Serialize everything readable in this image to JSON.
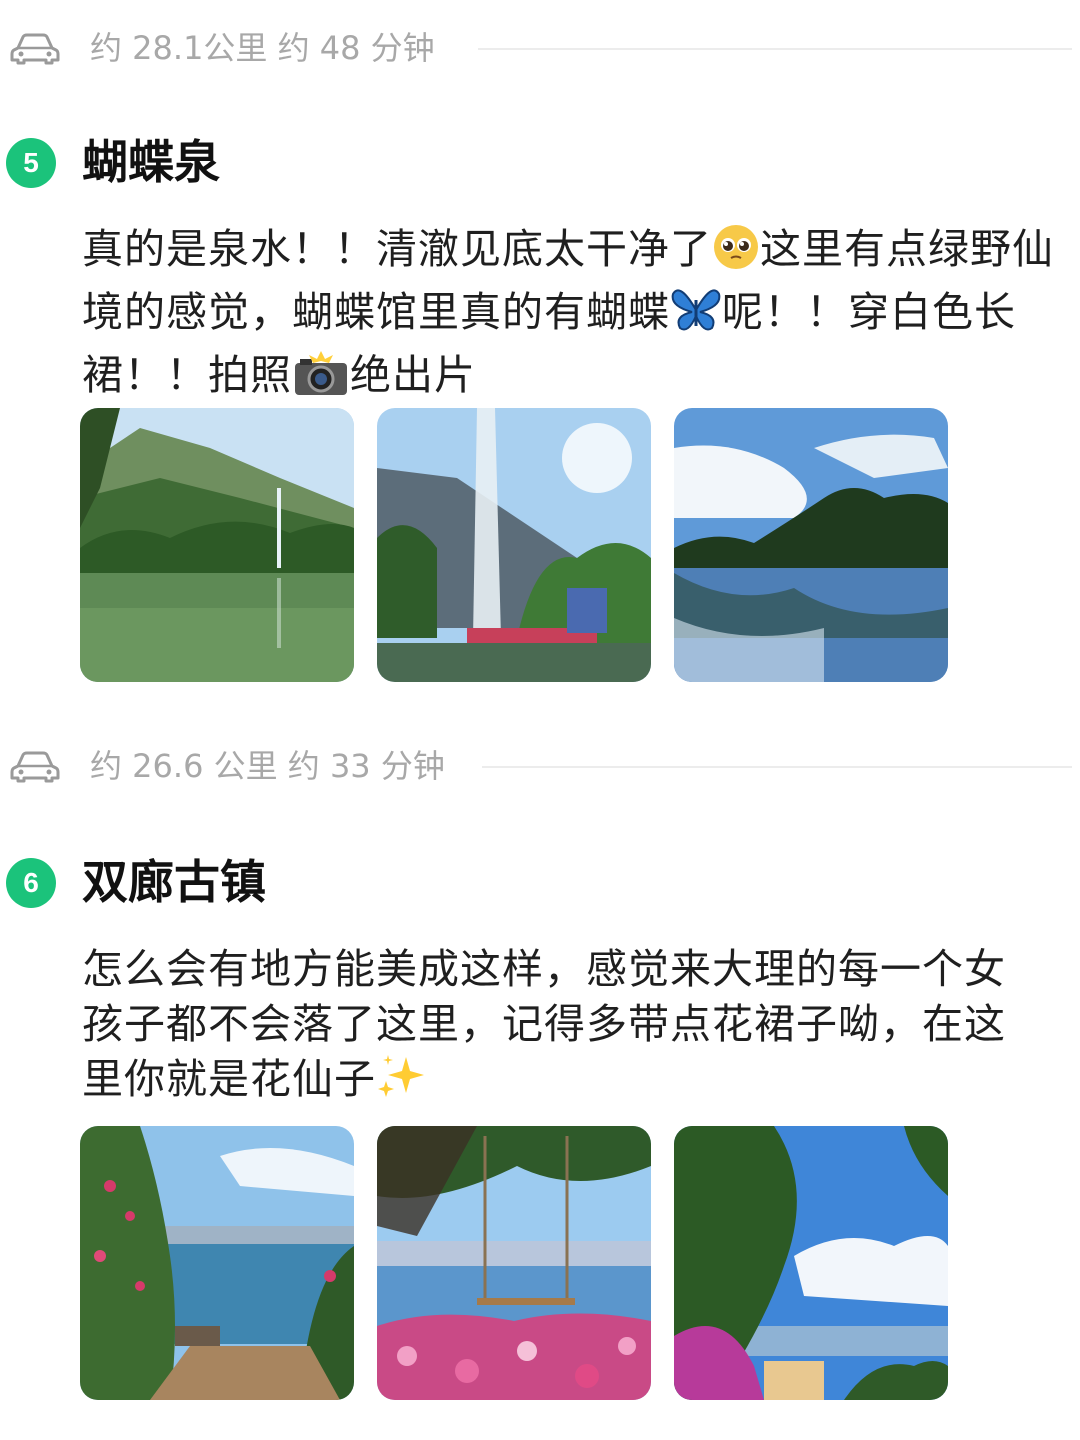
{
  "routes": [
    {
      "text": "约 28.1公里 约 48 分钟"
    },
    {
      "text": "约 26.6 公里 约 33 分钟"
    }
  ],
  "spots": [
    {
      "number": "5",
      "title": "蝴蝶泉",
      "desc_part1": "真的是泉水！！清澈见底太干净了",
      "desc_emoji1": "pleading-face-emoji",
      "desc_part2": "这里有点绿野仙境的感觉，蝴蝶馆里真的有蝴蝶",
      "desc_emoji2": "butterfly-emoji",
      "desc_part3": "呢！！穿白色长裙！！拍照",
      "desc_emoji3": "camera-flash-emoji",
      "desc_part4": "绝出片"
    },
    {
      "number": "6",
      "title": "双廊古镇",
      "desc_part1": "怎么会有地方能美成这样，感觉来大理的每一个女孩子都不会落了这里，记得多带点花裙子呦，在这里你就是花仙子",
      "desc_emoji1": "sparkles-emoji"
    }
  ],
  "colors": {
    "badge": "#1bc37b",
    "route_text": "#a8a8a8"
  }
}
